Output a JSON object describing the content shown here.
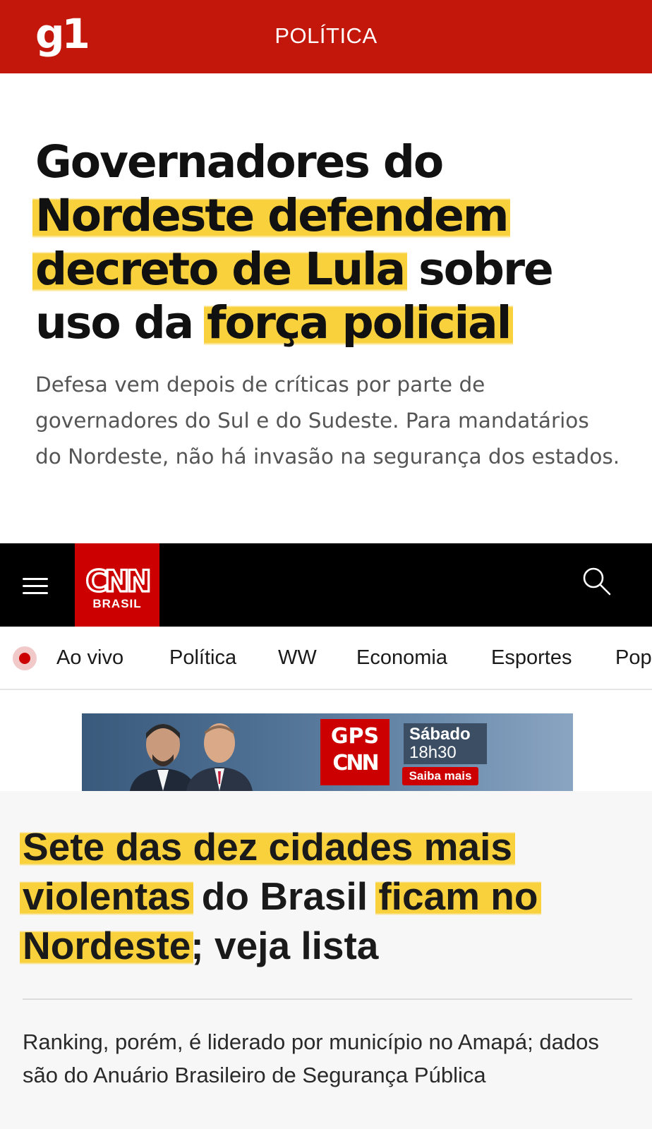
{
  "g1": {
    "logo": "g1",
    "section": "POLÍTICA",
    "headline": {
      "part1": "Governadores do",
      "hl1": "Nordeste defendem decreto de Lula",
      "part2": "sobre uso da",
      "hl2": "força policial"
    },
    "summary": "Defesa vem depois de críticas por parte de governadores do Sul e do Sudeste. Para mandatários do Nordeste, não há invasão na segurança dos estados.",
    "highlight_color": "#f9d13c",
    "brand_color": "#c4170c"
  },
  "cnn": {
    "logo_text": "CNN",
    "logo_sub": "BRASIL",
    "brand_color": "#cc0000",
    "icons": {
      "menu": "hamburger-menu-icon",
      "search": "search-icon",
      "live": "live-dot-icon"
    },
    "nav": [
      "Ao vivo",
      "Política",
      "WW",
      "Economia",
      "Esportes",
      "Pop"
    ],
    "banner": {
      "program_top": "GPS",
      "program_bottom": "CNN",
      "day": "Sábado",
      "time": "18h30",
      "cta": "Saiba mais"
    },
    "headline": {
      "hl1": "Sete das dez cidades mais violentas",
      "part1": "do Brasil",
      "hl2": "ficam no Nordeste",
      "part2": "; veja lista"
    },
    "summary": "Ranking, porém, é liderado por município no Amapá; dados são do Anuário Brasileiro de Segurança Pública"
  }
}
